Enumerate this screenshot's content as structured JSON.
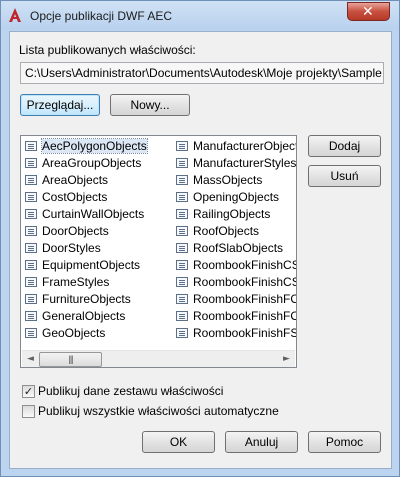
{
  "window": {
    "title": "Opcje publikacji DWF AEC",
    "close_glyph": "✕"
  },
  "published_props_label": "Lista publikowanych właściwości:",
  "path_value": "C:\\Users\\Administrator\\Documents\\Autodesk\\Moje projekty\\Sample Projects\\",
  "buttons": {
    "browse": "Przeglądaj...",
    "new": "Nowy...",
    "add": "Dodaj",
    "remove": "Usuń",
    "ok": "OK",
    "cancel": "Anuluj",
    "help": "Pomoc"
  },
  "list": {
    "selected": "AecPolygonObjects",
    "column1": [
      "AecPolygonObjects",
      "AreaGroupObjects",
      "AreaObjects",
      "CostObjects",
      "CurtainWallObjects",
      "DoorObjects",
      "DoorStyles",
      "EquipmentObjects",
      "FrameStyles",
      "FurnitureObjects",
      "GeneralObjects",
      "GeoObjects"
    ],
    "column2": [
      "ManufacturerObjects",
      "ManufacturerStyles",
      "MassObjects",
      "OpeningObjects",
      "RailingObjects",
      "RoofObjects",
      "RoofSlabObjects",
      "RoombookFinishCS_IN",
      "RoombookFinishCS_VO",
      "RoombookFinishFO_IN",
      "RoombookFinishFO_VO",
      "RoombookFinishFS_IN"
    ],
    "scroll_left": "◄",
    "scroll_right": "►",
    "thumb_grip": "|||"
  },
  "options": {
    "publish_set_data": {
      "label": "Publikuj dane zestawu właściwości",
      "checked": true,
      "mark": "✓"
    },
    "publish_all_auto": {
      "label": "Publikuj wszystkie właściwości automatyczne",
      "checked": false
    }
  },
  "colors": {
    "accent": "#3c7fb1",
    "close": "#c8503f",
    "app_icon": "#c0272d"
  }
}
